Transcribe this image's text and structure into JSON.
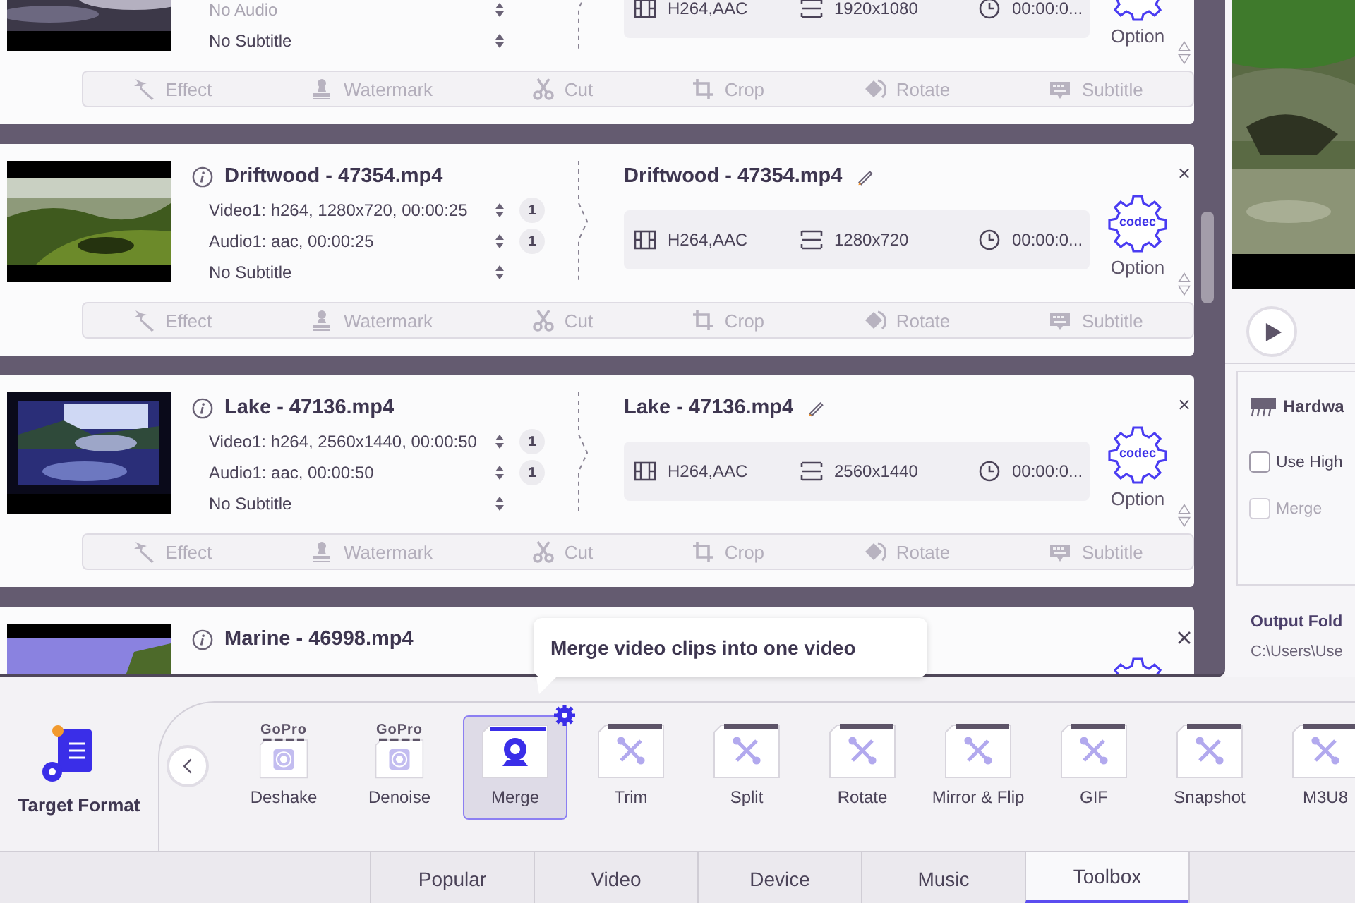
{
  "file_list": {
    "cards": [
      {
        "streams": [
          {
            "kind": "audio",
            "text": "No Audio",
            "disabled": true
          },
          {
            "kind": "subtitle",
            "text": "No Subtitle",
            "disabled": false
          }
        ],
        "output": {
          "specs": {
            "codec": "H264,AAC",
            "resolution": "1920x1080",
            "duration": "00:00:0..."
          }
        },
        "option_label": "Option",
        "tools": [
          {
            "kind": "effect",
            "label": "Effect"
          },
          {
            "kind": "watermark",
            "label": "Watermark"
          },
          {
            "kind": "cut",
            "label": "Cut"
          },
          {
            "kind": "crop",
            "label": "Crop"
          },
          {
            "kind": "rotate",
            "label": "Rotate"
          },
          {
            "kind": "subtitle",
            "label": "Subtitle"
          }
        ]
      },
      {
        "title": "Driftwood - 47354.mp4",
        "streams": [
          {
            "kind": "video",
            "text": "Video1: h264, 1280x720, 00:00:25",
            "count": "1",
            "disabled": false
          },
          {
            "kind": "audio",
            "text": "Audio1: aac, 00:00:25",
            "count": "1",
            "disabled": false
          },
          {
            "kind": "subtitle",
            "text": "No Subtitle",
            "disabled": false
          }
        ],
        "output": {
          "title": "Driftwood - 47354.mp4",
          "specs": {
            "codec": "H264,AAC",
            "resolution": "1280x720",
            "duration": "00:00:0..."
          }
        },
        "codec_label": "codec",
        "option_label": "Option",
        "tools": [
          {
            "kind": "effect",
            "label": "Effect"
          },
          {
            "kind": "watermark",
            "label": "Watermark"
          },
          {
            "kind": "cut",
            "label": "Cut"
          },
          {
            "kind": "crop",
            "label": "Crop"
          },
          {
            "kind": "rotate",
            "label": "Rotate"
          },
          {
            "kind": "subtitle",
            "label": "Subtitle"
          }
        ]
      },
      {
        "title": "Lake - 47136.mp4",
        "streams": [
          {
            "kind": "video",
            "text": "Video1: h264, 2560x1440, 00:00:50",
            "count": "1",
            "disabled": false
          },
          {
            "kind": "audio",
            "text": "Audio1: aac, 00:00:50",
            "count": "1",
            "disabled": false
          },
          {
            "kind": "subtitle",
            "text": "No Subtitle",
            "disabled": false
          }
        ],
        "output": {
          "title": "Lake - 47136.mp4",
          "specs": {
            "codec": "H264,AAC",
            "resolution": "2560x1440",
            "duration": "00:00:0..."
          }
        },
        "codec_label": "codec",
        "option_label": "Option",
        "tools": [
          {
            "kind": "effect",
            "label": "Effect"
          },
          {
            "kind": "watermark",
            "label": "Watermark"
          },
          {
            "kind": "cut",
            "label": "Cut"
          },
          {
            "kind": "crop",
            "label": "Crop"
          },
          {
            "kind": "rotate",
            "label": "Rotate"
          },
          {
            "kind": "subtitle",
            "label": "Subtitle"
          }
        ]
      },
      {
        "title": "Marine - 46998.mp4"
      }
    ]
  },
  "tooltip": {
    "text": "Merge video clips into one video"
  },
  "side_panel": {
    "hardware_label": "Hardwa",
    "options": [
      {
        "label": "Use High",
        "checked": false,
        "disabled": false
      },
      {
        "label": "Merge",
        "checked": false,
        "disabled": true
      }
    ],
    "output_folder_label": "Output Fold",
    "output_folder_path": "C:\\Users\\Use"
  },
  "toolbox": {
    "target_format": "Target Format",
    "items": [
      {
        "kind": "gopro",
        "badge": "GoPro",
        "label": "Deshake",
        "selected": false
      },
      {
        "kind": "gopro",
        "badge": "GoPro",
        "label": "Denoise",
        "selected": false
      },
      {
        "kind": "webcam",
        "label": "Merge",
        "selected": true
      },
      {
        "kind": "tool",
        "label": "Trim",
        "selected": false
      },
      {
        "kind": "tool",
        "label": "Split",
        "selected": false
      },
      {
        "kind": "tool",
        "label": "Rotate",
        "selected": false
      },
      {
        "kind": "tool",
        "label": "Mirror & Flip",
        "selected": false
      },
      {
        "kind": "tool",
        "label": "GIF",
        "selected": false
      },
      {
        "kind": "tool",
        "label": "Snapshot",
        "selected": false
      },
      {
        "kind": "tool",
        "label": "M3U8",
        "selected": false
      }
    ]
  },
  "tabs": [
    {
      "label": "Popular",
      "selected": false
    },
    {
      "label": "Video",
      "selected": false
    },
    {
      "label": "Device",
      "selected": false
    },
    {
      "label": "Music",
      "selected": false
    },
    {
      "label": "Toolbox",
      "selected": true
    }
  ]
}
